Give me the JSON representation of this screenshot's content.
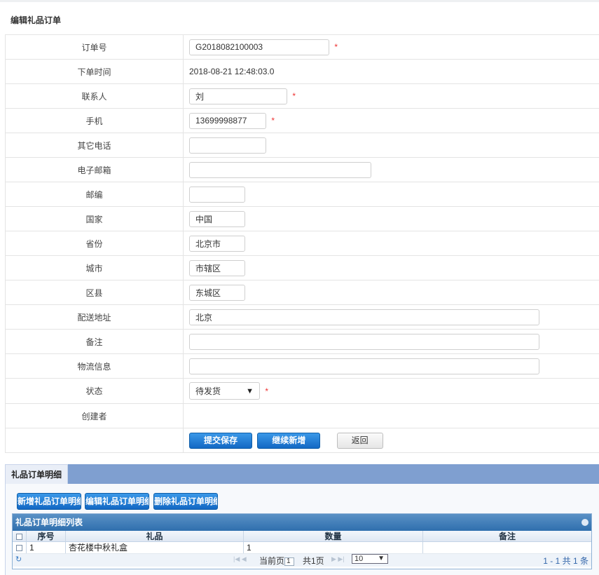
{
  "page_title": "编辑礼品订单",
  "form": {
    "order_no": {
      "label": "订单号",
      "value": "G2018082100003"
    },
    "order_time": {
      "label": "下单时间",
      "value": "2018-08-21 12:48:03.0"
    },
    "contact": {
      "label": "联系人",
      "value": "刘"
    },
    "mobile": {
      "label": "手机",
      "value": "13699998877"
    },
    "other_phone": {
      "label": "其它电话",
      "value": ""
    },
    "email": {
      "label": "电子邮箱",
      "value": ""
    },
    "zip": {
      "label": "邮编",
      "value": ""
    },
    "country": {
      "label": "国家",
      "value": "中国"
    },
    "province": {
      "label": "省份",
      "value": "北京市"
    },
    "city": {
      "label": "城市",
      "value": "市辖区"
    },
    "district": {
      "label": "区县",
      "value": "东城区"
    },
    "address": {
      "label": "配送地址",
      "value": "北京"
    },
    "remark": {
      "label": "备注",
      "value": ""
    },
    "logistics": {
      "label": "物流信息",
      "value": ""
    },
    "status": {
      "label": "状态",
      "value": "待发货"
    },
    "creator": {
      "label": "创建者",
      "value": ""
    },
    "required_mark": "*"
  },
  "actions": {
    "submit": "提交保存",
    "continue_add": "继续新增",
    "back": "返回"
  },
  "detail": {
    "tab_label": "礼品订单明细",
    "buttons": {
      "add": "新增礼品订单明细",
      "edit": "编辑礼品订单明细",
      "delete": "删除礼品订单明细"
    },
    "grid": {
      "title": "礼品订单明细列表",
      "columns": [
        "序号",
        "礼品",
        "数量",
        "备注"
      ],
      "rows": [
        {
          "index": "1",
          "gift": "杏花楼中秋礼盒",
          "qty": "1",
          "remark": ""
        }
      ],
      "pager": {
        "current_prefix": "当前页",
        "current_page": "1",
        "total_pages": "共1页",
        "page_size": "10",
        "info": "1 - 1   共 1 条"
      }
    }
  },
  "colors": {
    "primary_button": "#1f78d1",
    "detail_bar": "#7f9fd0",
    "grid_header": "#3f7ebb",
    "required": "#ee3333"
  }
}
